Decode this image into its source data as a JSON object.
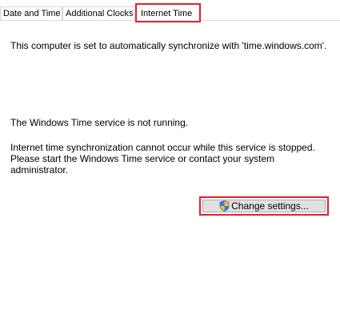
{
  "tabs": [
    {
      "label": "Date and Time"
    },
    {
      "label": "Additional Clocks"
    },
    {
      "label": "Internet Time"
    }
  ],
  "content": {
    "sync_status": "This computer is set to automatically synchronize with 'time.windows.com'.",
    "service_status": "The Windows Time service is not running.",
    "info_line1": "Internet time synchronization cannot occur while this service is stopped.",
    "info_line2": "Please start the Windows Time service or contact your system",
    "info_line3": "administrator."
  },
  "buttons": {
    "change_settings_label": "Change settings...",
    "change_settings_icon": "uac-shield-icon"
  },
  "colors": {
    "highlight": "#e0202e",
    "button_face": "#e1e1e1"
  }
}
